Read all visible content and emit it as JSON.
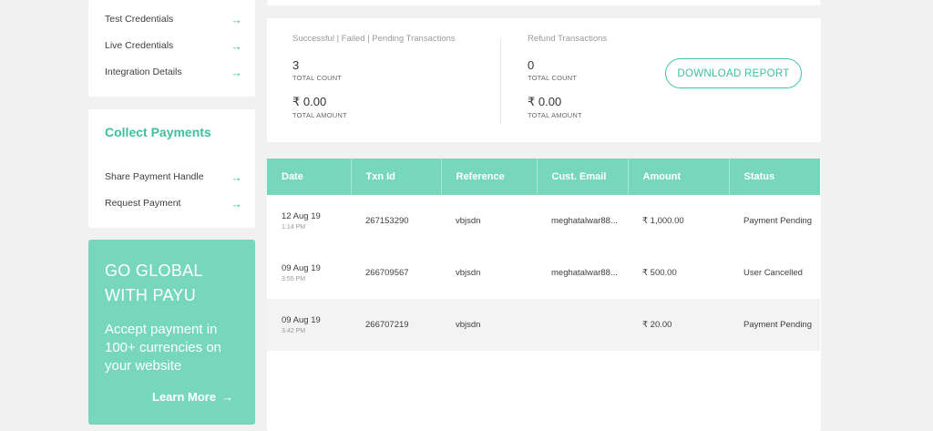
{
  "sidebar": {
    "credentials_links": [
      {
        "label": "Test Credentials"
      },
      {
        "label": "Live Credentials"
      },
      {
        "label": "Integration Details"
      }
    ],
    "collect": {
      "title": "Collect Payments",
      "links": [
        {
          "label": "Share Payment Handle"
        },
        {
          "label": "Request Payment"
        }
      ]
    },
    "promo": {
      "title": "GO GLOBAL WITH PAYU",
      "description": "Accept payment in 100+ currencies on your website",
      "link_label": "Learn More"
    }
  },
  "summary": {
    "transactions": {
      "heading": "Successful | Failed | Pending Transactions",
      "count": "3",
      "count_label": "TOTAL COUNT",
      "amount": "₹ 0.00",
      "amount_label": "TOTAL AMOUNT"
    },
    "refunds": {
      "heading": "Refund Transactions",
      "count": "0",
      "count_label": "TOTAL COUNT",
      "amount": "₹ 0.00",
      "amount_label": "TOTAL AMOUNT"
    },
    "download_label": "DOWNLOAD REPORT"
  },
  "table": {
    "columns": [
      "Date",
      "Txn Id",
      "Reference",
      "Cust. Email",
      "Amount",
      "Status"
    ],
    "rows": [
      {
        "date": "12 Aug 19",
        "time": "1:14 PM",
        "txn_id": "267153290",
        "reference": "vbjsdn",
        "email": "meghatalwar88...",
        "amount": "₹ 1,000.00",
        "status": "Payment Pending"
      },
      {
        "date": "09 Aug 19",
        "time": "3:55 PM",
        "txn_id": "266709567",
        "reference": "vbjsdn",
        "email": "meghatalwar88...",
        "amount": "₹ 500.00",
        "status": "User Cancelled"
      },
      {
        "date": "09 Aug 19",
        "time": "3:42 PM",
        "txn_id": "266707219",
        "reference": "vbjsdn",
        "email": "",
        "amount": "₹ 20.00",
        "status": "Payment Pending"
      }
    ]
  },
  "icons": {
    "arrow": "→"
  },
  "colors": {
    "accent": "#76d7bd",
    "accent_text": "#3fbf9f",
    "background": "#f1f1f1"
  }
}
